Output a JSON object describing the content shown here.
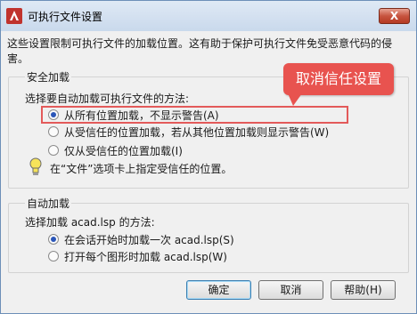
{
  "window": {
    "title": "可执行文件设置",
    "close_label": "X",
    "description": "这些设置限制可执行文件的加载位置。这有助于保护可执行文件免受恶意代码的侵害。"
  },
  "security_group": {
    "title": "安全加载",
    "prompt": "选择要自动加载可执行文件的方法:",
    "options": [
      {
        "label": "从所有位置加载，不显示警告(A)",
        "checked": true
      },
      {
        "label": "从受信任的位置加载，若从其他位置加载则显示警告(W)",
        "checked": false
      },
      {
        "label": "仅从受信任的位置加载(I)",
        "checked": false
      }
    ],
    "tip": "在“文件”选项卡上指定受信任的位置。",
    "tip_icon": "lightbulb-icon"
  },
  "autoload_group": {
    "title": "自动加载",
    "prompt": "选择加载 acad.lsp 的方法:",
    "options": [
      {
        "label": "在会话开始时加载一次 acad.lsp(S)",
        "checked": true
      },
      {
        "label": "打开每个图形时加载 acad.lsp(W)",
        "checked": false
      }
    ]
  },
  "buttons": {
    "ok": "确定",
    "cancel": "取消",
    "help": "帮助(H)"
  },
  "annotation": {
    "callout_text": "取消信任设置",
    "color": "#e8534f"
  }
}
